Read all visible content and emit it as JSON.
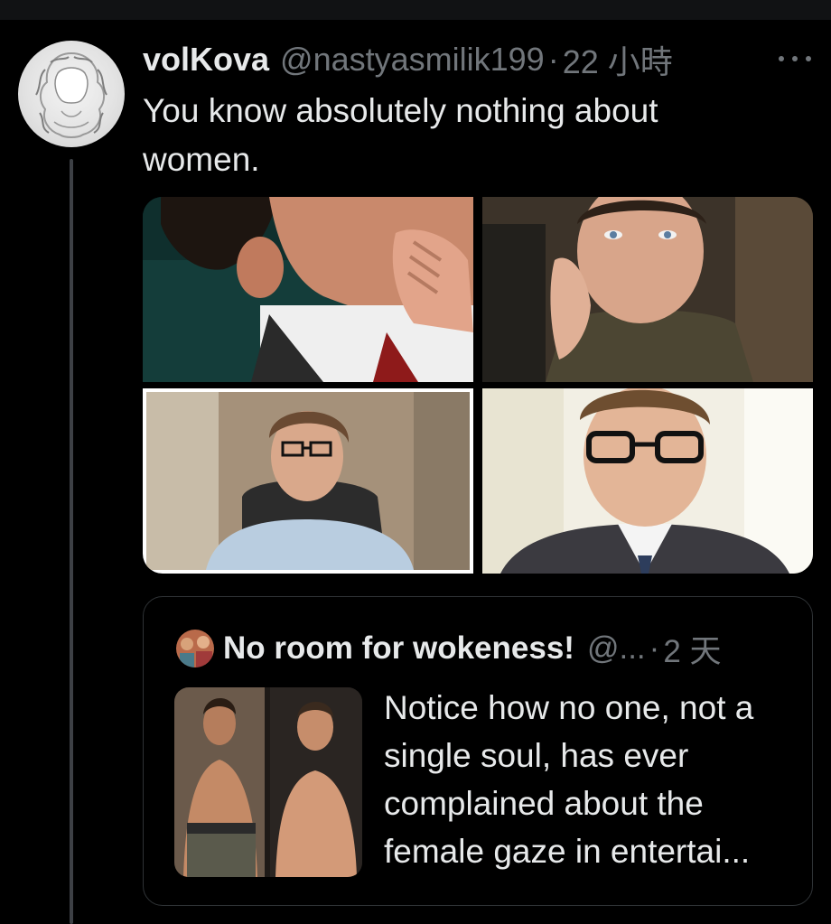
{
  "tweet": {
    "author_name": "volKova",
    "author_handle": "@nastyasmilik199",
    "separator": "·",
    "time": "22 小時",
    "text": "You know absolutely nothing about women.",
    "media": [
      {
        "subject": "man-touching-neck-photo"
      },
      {
        "subject": "man-hand-on-cheek-photo"
      },
      {
        "subject": "man-glasses-smiling-photo"
      },
      {
        "subject": "man-glasses-suit-photo"
      }
    ]
  },
  "quote": {
    "author_name": "No room for wokeness!",
    "author_handle": "@...",
    "separator": "·",
    "time": "2 天",
    "text": "Notice how no one, not a single soul, has ever complained about the female gaze in entertai...",
    "media": {
      "subject": "shirtless-men-photo"
    }
  },
  "icons": {
    "more": "more-horizontal-icon"
  },
  "colors": {
    "background": "#000000",
    "text_primary": "#e7e9ea",
    "text_secondary": "#71767b",
    "border": "#2f3336",
    "thread_line": "#3d4045"
  }
}
